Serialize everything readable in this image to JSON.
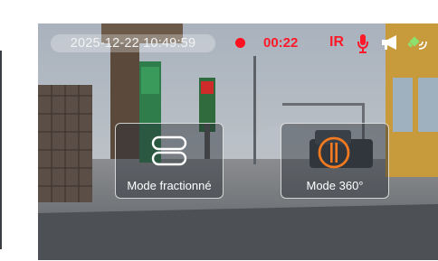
{
  "overlay": {
    "timestamp": "2025-12-22 10:49:59",
    "recording_time": "00:22",
    "ir_label": "IR"
  },
  "modes": [
    {
      "label": "Mode fractionné",
      "icon": "split-view-icon"
    },
    {
      "label": "Mode 360°",
      "icon": "panorama-360-icon"
    }
  ],
  "status_icons": [
    "microphone-icon",
    "megaphone-icon",
    "gps-signal-icon"
  ],
  "colors": {
    "record_red": "#ff1828",
    "mode360_orange": "#f47a1f"
  }
}
